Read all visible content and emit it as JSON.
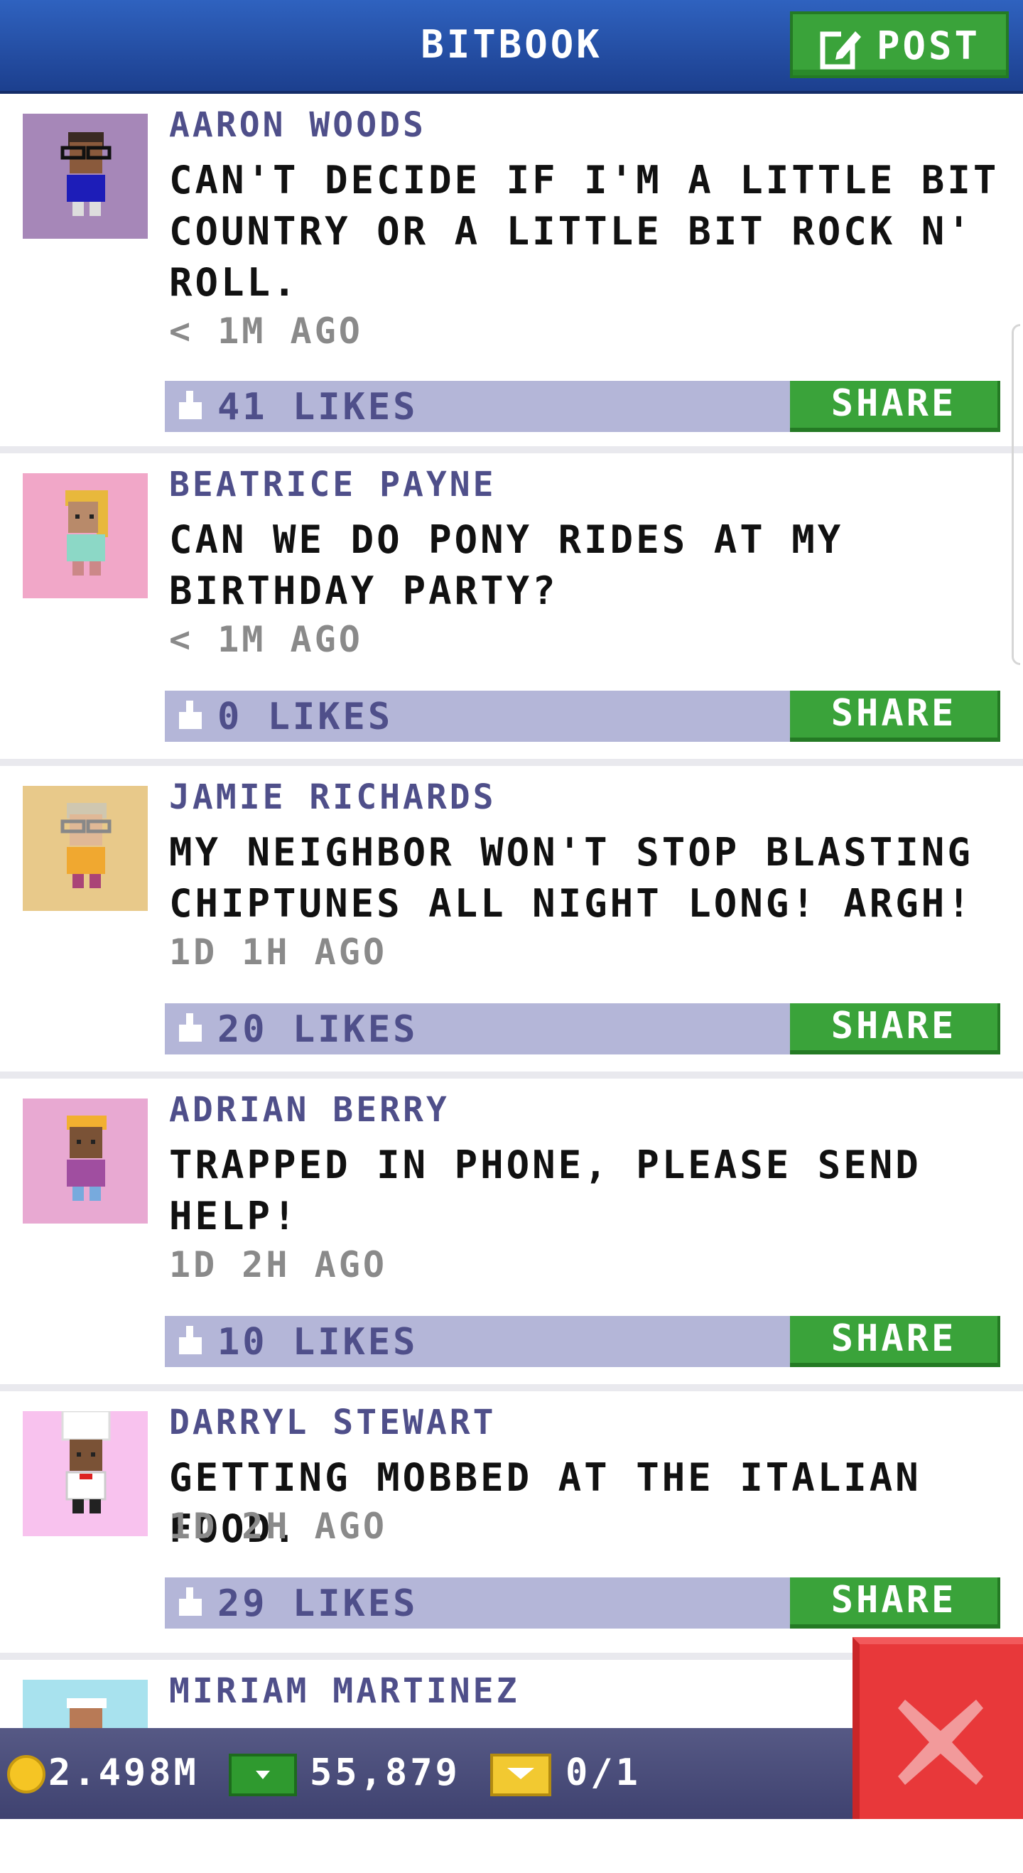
{
  "header": {
    "title": "BITBOOK",
    "post_label": "POST",
    "post_icon": "edit-icon"
  },
  "posts": [
    {
      "name": "AARON WOODS",
      "message": "CAN'T DECIDE IF I'M A LITTLE BIT COUNTRY OR A LITTLE BIT ROCK N' ROLL.",
      "time": "< 1M AGO",
      "likes": "41 LIKES",
      "share": "SHARE",
      "avatar_bg": "#a687b8"
    },
    {
      "name": "BEATRICE PAYNE",
      "message": "CAN WE DO PONY RIDES AT MY BIRTHDAY PARTY?",
      "time": "< 1M AGO",
      "likes": "0 LIKES",
      "share": "SHARE",
      "avatar_bg": "#f1a7c8"
    },
    {
      "name": "JAMIE RICHARDS",
      "message": "MY NEIGHBOR WON'T STOP BLASTING CHIPTUNES ALL NIGHT LONG! ARGH!",
      "time": "1D 1H AGO",
      "likes": "20 LIKES",
      "share": "SHARE",
      "avatar_bg": "#e8c98a"
    },
    {
      "name": "ADRIAN BERRY",
      "message": "TRAPPED IN PHONE, PLEASE SEND HELP!",
      "time": "1D 2H AGO",
      "likes": "10 LIKES",
      "share": "SHARE",
      "avatar_bg": "#e8a9d2"
    },
    {
      "name": "DARRYL STEWART",
      "message": "GETTING MOBBED AT THE ITALIAN FOOD.",
      "time": "1D 2H AGO",
      "likes": "29 LIKES",
      "share": "SHARE",
      "avatar_bg": "#f8c2ee"
    },
    {
      "name": "MIRIAM MARTINEZ",
      "avatar_bg": "#a8e2ee"
    }
  ],
  "bottom_bar": {
    "coins": "2.498M",
    "cash": "55,879",
    "bux": "0/1",
    "coin_icon": "coin-icon",
    "cash_icon": "cash-icon",
    "bux_icon": "bux-icon"
  },
  "colors": {
    "header": "#2356b0",
    "green": "#3aa33a",
    "like_bar": "#b4b6d8",
    "name_text": "#4f4f8a",
    "close_red": "#e8383a"
  }
}
